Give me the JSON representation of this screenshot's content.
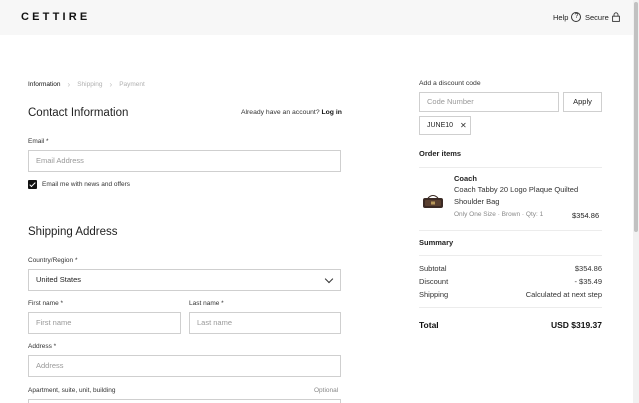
{
  "header": {
    "logo": "CETTIRE",
    "help_label": "Help",
    "help_icon": "question-circle-icon",
    "secure_label": "Secure",
    "secure_icon": "lock-icon"
  },
  "breadcrumb": {
    "steps": [
      "Information",
      "Shipping",
      "Payment"
    ],
    "active": "Information"
  },
  "contact": {
    "title": "Contact Information",
    "account_prompt": "Already have an account?",
    "login_link": "Log in",
    "email_label": "Email *",
    "email_placeholder": "Email Address",
    "newsletter_checked": true,
    "newsletter_label": "Email me with news and offers"
  },
  "shipping": {
    "title": "Shipping Address",
    "country_label": "Country/Region *",
    "country_value": "United States",
    "first_name_label": "First name *",
    "first_name_placeholder": "First name",
    "last_name_label": "Last name *",
    "last_name_placeholder": "Last name",
    "address_label": "Address *",
    "address_placeholder": "Address",
    "apartment_label": "Apartment, suite, unit, building",
    "apartment_optional": "Optional"
  },
  "discount": {
    "label": "Add a discount code",
    "placeholder": "Code Number",
    "apply_label": "Apply",
    "applied_code": "JUNE10"
  },
  "order": {
    "title": "Order items",
    "items": [
      {
        "brand": "Coach",
        "name": "Coach Tabby 20 Logo Plaque Quilted Shoulder Bag",
        "variant": "Only One Size  ·  Brown  ·  Qty: 1",
        "price": "$354.86"
      }
    ]
  },
  "summary": {
    "title": "Summary",
    "subtotal_label": "Subtotal",
    "subtotal_value": "$354.86",
    "discount_label": "Discount",
    "discount_value": "- $35.49",
    "shipping_label": "Shipping",
    "shipping_value": "Calculated at next step",
    "total_label": "Total",
    "total_value": "USD $319.37"
  },
  "colors": {
    "header_bg": "#f7f7f7",
    "text_primary": "#111111",
    "border": "#cfcfcf",
    "muted": "#888888"
  }
}
